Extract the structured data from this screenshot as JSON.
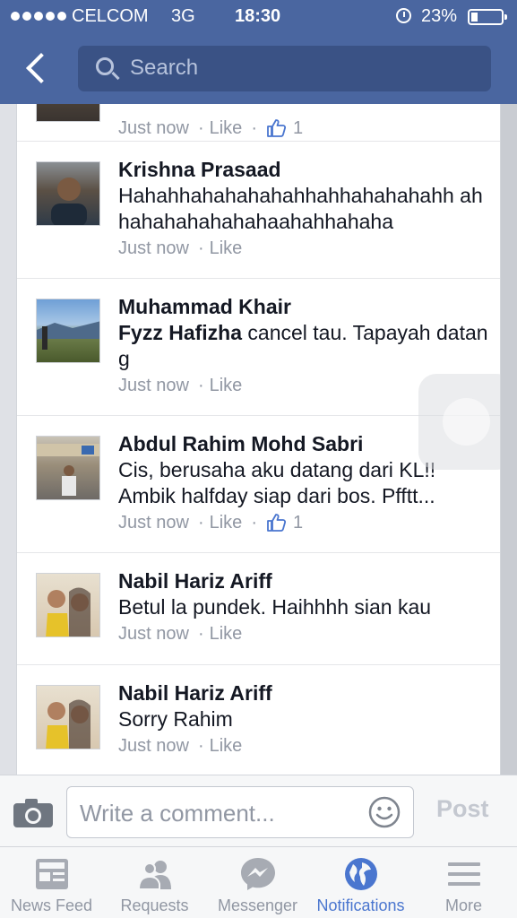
{
  "status_bar": {
    "carrier": "CELCOM",
    "network": "3G",
    "time": "18:30",
    "battery_percent": "23%",
    "battery_level": 0.23
  },
  "header": {
    "search_placeholder": "Search"
  },
  "comments": [
    {
      "author": "",
      "text": "",
      "time": "Just now",
      "like_label": "Like",
      "like_count": "1"
    },
    {
      "author": "Krishna Prasaad",
      "text": "Hahahhahahahahahhahhahahahahh ahhahahahahahahaahahhahaha",
      "time": "Just now",
      "like_label": "Like",
      "like_count": ""
    },
    {
      "author": "Muhammad Khair",
      "mention": "Fyzz Hafizha",
      "text": "cancel tau. Tapayah datang",
      "time": "Just now",
      "like_label": "Like",
      "like_count": ""
    },
    {
      "author": "Abdul Rahim Mohd Sabri",
      "text": "Cis, berusaha aku datang dari KL!! Ambik halfday siap dari bos. Pfftt...",
      "time": "Just now",
      "like_label": "Like",
      "like_count": "1"
    },
    {
      "author": "Nabil Hariz Ariff",
      "text": "Betul la pundek. Haihhhh sian kau",
      "time": "Just now",
      "like_label": "Like",
      "like_count": ""
    },
    {
      "author": "Nabil Hariz Ariff",
      "text": "Sorry Rahim",
      "time": "Just now",
      "like_label": "Like",
      "like_count": ""
    }
  ],
  "meta_separator": "·",
  "composer": {
    "placeholder": "Write a comment...",
    "post_label": "Post"
  },
  "tabs": [
    {
      "label": "News Feed",
      "icon": "news-feed-icon"
    },
    {
      "label": "Requests",
      "icon": "requests-icon"
    },
    {
      "label": "Messenger",
      "icon": "messenger-icon"
    },
    {
      "label": "Notifications",
      "icon": "notifications-globe-icon",
      "active": true
    },
    {
      "label": "More",
      "icon": "more-menu-icon"
    }
  ],
  "colors": {
    "header": "#4a66a0",
    "accent": "#4a76cf",
    "muted": "#9197a3",
    "text": "#141823"
  }
}
